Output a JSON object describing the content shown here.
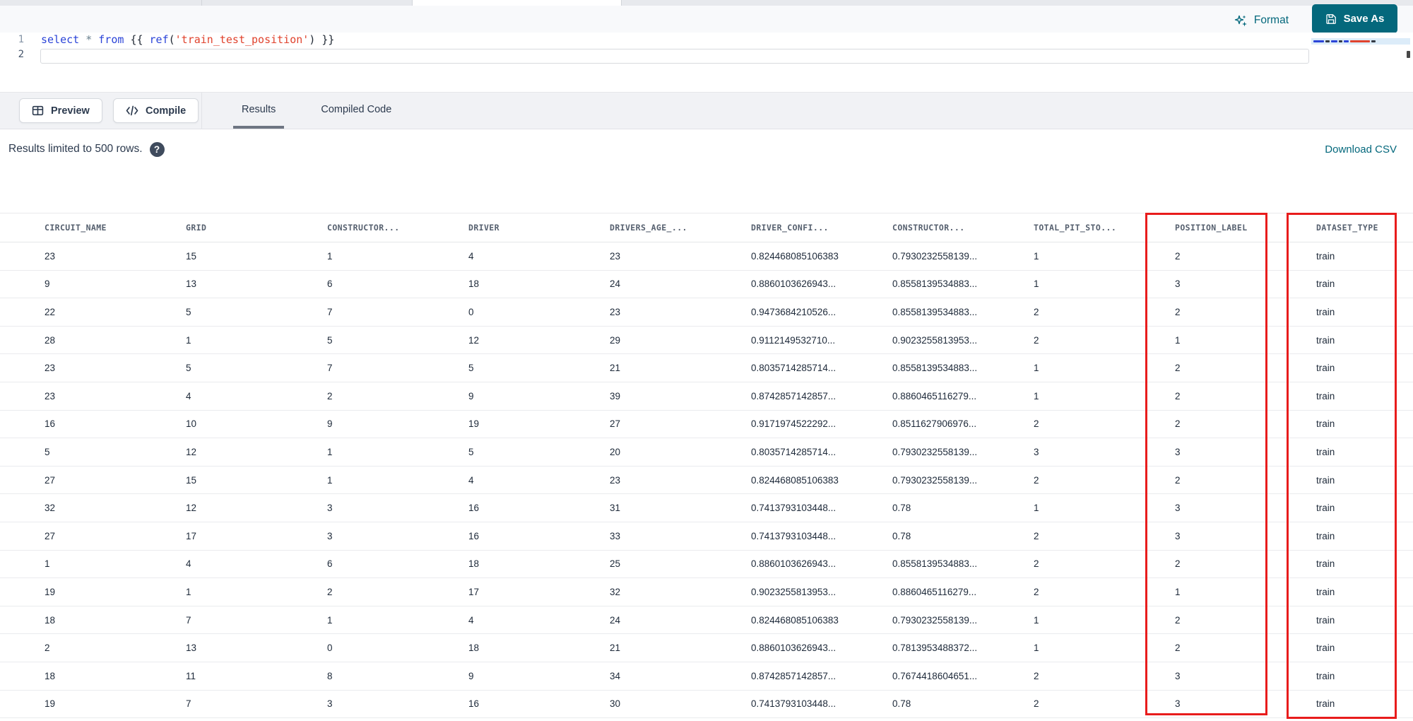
{
  "toolbar": {
    "format_label": "Format",
    "save_as_label": "Save As"
  },
  "editor": {
    "line_numbers": [
      "1",
      "2"
    ],
    "code_tokens": [
      {
        "text": "select",
        "type": "keyword"
      },
      {
        "text": " ",
        "type": "plain"
      },
      {
        "text": "*",
        "type": "operator"
      },
      {
        "text": " ",
        "type": "plain"
      },
      {
        "text": "from",
        "type": "keyword"
      },
      {
        "text": " ",
        "type": "plain"
      },
      {
        "text": "{{ ",
        "type": "brace"
      },
      {
        "text": "ref",
        "type": "function"
      },
      {
        "text": "(",
        "type": "plain"
      },
      {
        "text": "'train_test_position'",
        "type": "string"
      },
      {
        "text": ")",
        "type": "plain"
      },
      {
        "text": " }}",
        "type": "brace"
      }
    ]
  },
  "actions": {
    "preview_label": "Preview",
    "compile_label": "Compile"
  },
  "result_tabs": [
    {
      "label": "Results",
      "active": true
    },
    {
      "label": "Compiled Code",
      "active": false
    }
  ],
  "results_bar": {
    "message": "Results limited to 500 rows.",
    "help_glyph": "?",
    "download_label": "Download CSV"
  },
  "table": {
    "columns": [
      "CIRCUIT_NAME",
      "GRID",
      "CONSTRUCTOR...",
      "DRIVER",
      "DRIVERS_AGE_...",
      "DRIVER_CONFI...",
      "CONSTRUCTOR...",
      "TOTAL_PIT_STO...",
      "POSITION_LABEL",
      "DATASET_TYPE"
    ],
    "highlighted_columns": [
      "POSITION_LABEL",
      "DATASET_TYPE"
    ],
    "rows": [
      [
        "23",
        "15",
        "1",
        "4",
        "23",
        "0.824468085106383",
        "0.7930232558139...",
        "1",
        "2",
        "train"
      ],
      [
        "9",
        "13",
        "6",
        "18",
        "24",
        "0.8860103626943...",
        "0.8558139534883...",
        "1",
        "3",
        "train"
      ],
      [
        "22",
        "5",
        "7",
        "0",
        "23",
        "0.9473684210526...",
        "0.8558139534883...",
        "2",
        "2",
        "train"
      ],
      [
        "28",
        "1",
        "5",
        "12",
        "29",
        "0.9112149532710...",
        "0.9023255813953...",
        "2",
        "1",
        "train"
      ],
      [
        "23",
        "5",
        "7",
        "5",
        "21",
        "0.8035714285714...",
        "0.8558139534883...",
        "1",
        "2",
        "train"
      ],
      [
        "23",
        "4",
        "2",
        "9",
        "39",
        "0.8742857142857...",
        "0.8860465116279...",
        "1",
        "2",
        "train"
      ],
      [
        "16",
        "10",
        "9",
        "19",
        "27",
        "0.9171974522292...",
        "0.8511627906976...",
        "2",
        "2",
        "train"
      ],
      [
        "5",
        "12",
        "1",
        "5",
        "20",
        "0.8035714285714...",
        "0.7930232558139...",
        "3",
        "3",
        "train"
      ],
      [
        "27",
        "15",
        "1",
        "4",
        "23",
        "0.824468085106383",
        "0.7930232558139...",
        "2",
        "2",
        "train"
      ],
      [
        "32",
        "12",
        "3",
        "16",
        "31",
        "0.7413793103448...",
        "0.78",
        "1",
        "3",
        "train"
      ],
      [
        "27",
        "17",
        "3",
        "16",
        "33",
        "0.7413793103448...",
        "0.78",
        "2",
        "3",
        "train"
      ],
      [
        "1",
        "4",
        "6",
        "18",
        "25",
        "0.8860103626943...",
        "0.8558139534883...",
        "2",
        "2",
        "train"
      ],
      [
        "19",
        "1",
        "2",
        "17",
        "32",
        "0.9023255813953...",
        "0.8860465116279...",
        "2",
        "1",
        "train"
      ],
      [
        "18",
        "7",
        "1",
        "4",
        "24",
        "0.824468085106383",
        "0.7930232558139...",
        "1",
        "2",
        "train"
      ],
      [
        "2",
        "13",
        "0",
        "18",
        "21",
        "0.8860103626943...",
        "0.7813953488372...",
        "1",
        "2",
        "train"
      ],
      [
        "18",
        "11",
        "8",
        "9",
        "34",
        "0.8742857142857...",
        "0.7674418604651...",
        "2",
        "3",
        "train"
      ],
      [
        "19",
        "7",
        "3",
        "16",
        "30",
        "0.7413793103448...",
        "0.78",
        "2",
        "3",
        "train"
      ]
    ]
  },
  "colors": {
    "accent": "#04687c",
    "highlight_red": "#e81c1c",
    "keyword_blue": "#2b44d8",
    "string_red": "#e0432e",
    "operator_gray": "#69808e",
    "brace_dark": "#1f2733"
  }
}
